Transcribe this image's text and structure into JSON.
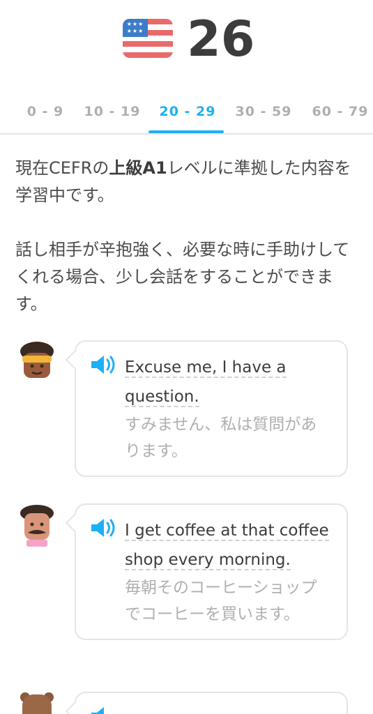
{
  "header": {
    "flag_icon": "us-flag-icon",
    "level": "26"
  },
  "tabs": [
    {
      "label": "0 - 9",
      "active": false
    },
    {
      "label": "10 - 19",
      "active": false
    },
    {
      "label": "20 - 29",
      "active": true
    },
    {
      "label": "30 - 59",
      "active": false
    },
    {
      "label": "60 - 79",
      "active": false
    }
  ],
  "description": {
    "line1_before": "現在CEFRの",
    "line1_bold": "上級A1",
    "line1_after": "レベルに準拠した内容を学習中です。",
    "paragraph2": "話し相手が辛抱強く、必要な時に手助けしてくれる場合、少し会話をすることができます。"
  },
  "dialogs": [
    {
      "avatar": "woman-headband-avatar",
      "english": "Excuse me, I have a question.",
      "japanese": "すみません、私は質問があります。"
    },
    {
      "avatar": "man-mustache-avatar",
      "english": "I get coffee at that coffee shop every morning.",
      "japanese": "毎朝そのコーヒーショップでコーヒーを買います。"
    },
    {
      "avatar": "bear-avatar",
      "english": "",
      "japanese": ""
    }
  ],
  "colors": {
    "accent": "#1cb0f6",
    "text": "#4b4b4b",
    "muted": "#afafaf",
    "border": "#e5e5e5"
  }
}
